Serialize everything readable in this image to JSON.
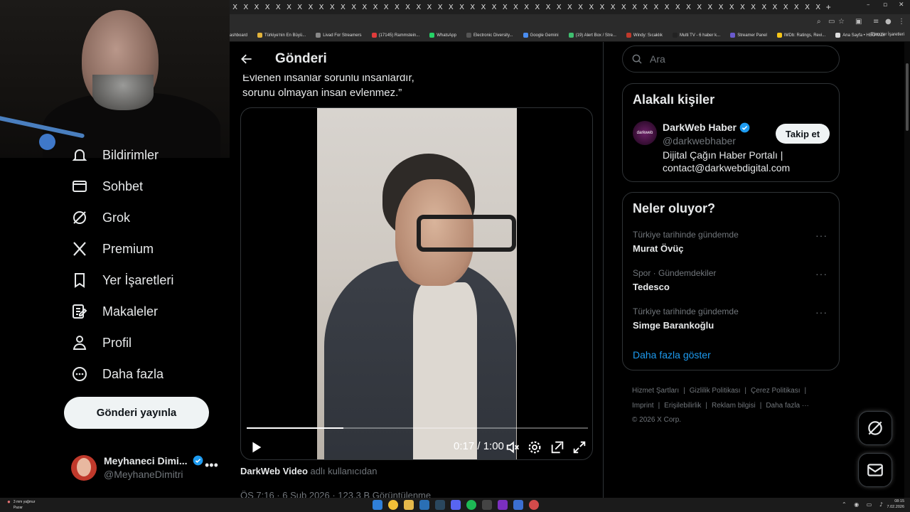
{
  "browser": {
    "tab_close_glyph": "X",
    "new_tab_glyph": "+",
    "bookmarks": [
      {
        "label": "ashboard",
        "color": "#2b2b2b"
      },
      {
        "label": "Türkiye'nin En Büyü...",
        "color": "#e2b33b"
      },
      {
        "label": "Livad For Streamers",
        "color": "#888888"
      },
      {
        "label": "(17145) Rammstein...",
        "color": "#e03b3b"
      },
      {
        "label": "WhatsApp",
        "color": "#25d366"
      },
      {
        "label": "Electronic Diversity...",
        "color": "#555555"
      },
      {
        "label": "Google Gemini",
        "color": "#4a8df0"
      },
      {
        "label": "(19) Alert Box / Stre...",
        "color": "#3fbf6f"
      },
      {
        "label": "Windy: Sıcaklık",
        "color": "#c0392b"
      },
      {
        "label": "Multi TV - 6 haber k...",
        "color": "#222222"
      },
      {
        "label": "Streamer Panel",
        "color": "#6a5acd"
      },
      {
        "label": "IMDb: Ratings, Revi...",
        "color": "#f5c518"
      },
      {
        "label": "Ana Sayfa • HBO Max",
        "color": "#dddddd"
      }
    ],
    "all_bookmarks": "Tüm Yer İşaretleri"
  },
  "nav": {
    "items": [
      {
        "label": "Bildirimler",
        "icon": "bell-icon"
      },
      {
        "label": "Sohbet",
        "icon": "mail-icon"
      },
      {
        "label": "Grok",
        "icon": "grok-icon"
      },
      {
        "label": "Premium",
        "icon": "x-logo-icon"
      },
      {
        "label": "Yer İşaretleri",
        "icon": "bookmark-icon"
      },
      {
        "label": "Makaleler",
        "icon": "article-icon"
      },
      {
        "label": "Profil",
        "icon": "person-icon"
      },
      {
        "label": "Daha fazla",
        "icon": "more-circle-icon"
      }
    ],
    "post_button": "Gönderi yayınla"
  },
  "account": {
    "name": "Meyhaneci Dimi...",
    "handle": "@MeyhaneDimitri",
    "more": "•••"
  },
  "post": {
    "page_title": "Gönderi",
    "quote_line1": "Evlenen insanlar sorunlu insanlardır,",
    "quote_line2": "sorunu olmayan insan evlenmez.”",
    "video": {
      "time": "0:17 / 1:00",
      "progress": 0.283
    },
    "credit_source": "DarkWeb Video",
    "credit_suffix": "adlı kullanıcıdan",
    "meta": "ÖS 7:16 · 6 Şub 2026 · 123,3 B Görüntülenme"
  },
  "search": {
    "placeholder": "Ara"
  },
  "related": {
    "title": "Alakalı kişiler",
    "name": "DarkWeb Haber",
    "handle": "@darkwebhaber",
    "avatar_text": "darkweb",
    "bio": "Dijital Çağın Haber Portalı | contact@darkwebdigital.com",
    "follow": "Takip et",
    "verified_color": "#1d9bf0"
  },
  "trends": {
    "title": "Neler oluyor?",
    "items": [
      {
        "context": "Türkiye tarihinde gündemde",
        "name": "Murat Övüç"
      },
      {
        "context": "Spor · Gündemdekiler",
        "name": "Tedesco"
      },
      {
        "context": "Türkiye tarihinde gündemde",
        "name": "Simge Barankoğlu"
      }
    ],
    "more_glyph": "···",
    "show_more": "Daha fazla göster"
  },
  "footer": {
    "links": [
      "Hizmet Şartları",
      "Gizlilik Politikası",
      "Çerez Politikası",
      "Imprint",
      "Erişilebilirlik",
      "Reklam bilgisi",
      "Daha fazla ···"
    ],
    "copyright": "© 2026 X Corp."
  },
  "taskbar": {
    "weather_temp": "3 mm yağmur",
    "weather_desc": "Pazar",
    "time": "08:15",
    "date": "7.02.2026"
  }
}
